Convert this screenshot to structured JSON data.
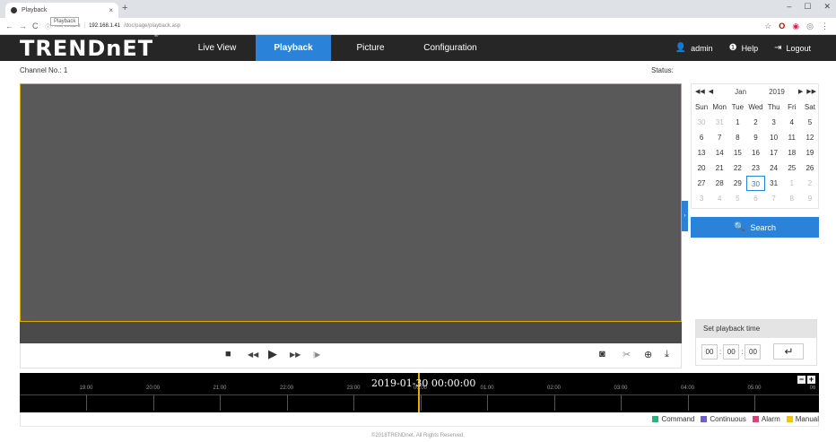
{
  "browser": {
    "tab_title": "Playback",
    "tab_close": "×",
    "new_tab": "+",
    "tooltip": "Playback",
    "not_secure": "Not secure",
    "url_host": "192.168.1.41",
    "url_path": "/doc/page/playback.asp",
    "window_controls": [
      "–",
      "☐",
      "✕"
    ]
  },
  "header": {
    "logo": "TRENDnET",
    "menu": [
      {
        "label": "Live View",
        "active": false
      },
      {
        "label": "Playback",
        "active": true
      },
      {
        "label": "Picture",
        "active": false
      },
      {
        "label": "Configuration",
        "active": false
      }
    ],
    "user": "admin",
    "help": "Help",
    "logout": "Logout"
  },
  "channel_label": "Channel No.: 1",
  "status_label": "Status:",
  "calendar": {
    "month": "Jan",
    "year": "2019",
    "dow": [
      "Sun",
      "Mon",
      "Tue",
      "Wed",
      "Thu",
      "Fri",
      "Sat"
    ],
    "weeks": [
      [
        [
          "30",
          "muted"
        ],
        [
          "31",
          "muted"
        ],
        [
          "1",
          ""
        ],
        [
          "2",
          ""
        ],
        [
          "3",
          ""
        ],
        [
          "4",
          ""
        ],
        [
          "5",
          ""
        ]
      ],
      [
        [
          "6",
          ""
        ],
        [
          "7",
          ""
        ],
        [
          "8",
          ""
        ],
        [
          "9",
          ""
        ],
        [
          "10",
          ""
        ],
        [
          "11",
          ""
        ],
        [
          "12",
          ""
        ]
      ],
      [
        [
          "13",
          ""
        ],
        [
          "14",
          ""
        ],
        [
          "15",
          ""
        ],
        [
          "16",
          ""
        ],
        [
          "17",
          ""
        ],
        [
          "18",
          ""
        ],
        [
          "19",
          ""
        ]
      ],
      [
        [
          "20",
          ""
        ],
        [
          "21",
          ""
        ],
        [
          "22",
          ""
        ],
        [
          "23",
          ""
        ],
        [
          "24",
          ""
        ],
        [
          "25",
          ""
        ],
        [
          "26",
          ""
        ]
      ],
      [
        [
          "27",
          ""
        ],
        [
          "28",
          ""
        ],
        [
          "29",
          ""
        ],
        [
          "30",
          "sel"
        ],
        [
          "31",
          ""
        ],
        [
          "1",
          "muted"
        ],
        [
          "2",
          "muted"
        ]
      ],
      [
        [
          "3",
          "muted"
        ],
        [
          "4",
          "muted"
        ],
        [
          "5",
          "muted"
        ],
        [
          "6",
          "muted"
        ],
        [
          "7",
          "muted"
        ],
        [
          "8",
          "muted"
        ],
        [
          "9",
          "muted"
        ]
      ]
    ]
  },
  "search_label": "Search",
  "playback_time": {
    "title": "Set playback time",
    "hh": "00",
    "mm": "00",
    "ss": "00"
  },
  "timeline": {
    "current": "2019-01-30 00:00:00",
    "labels": [
      "19:00",
      "20:00",
      "21:00",
      "22:00",
      "23:00",
      "00:00",
      "01:00",
      "02:00",
      "03:00",
      "04:00",
      "05:00",
      "06"
    ]
  },
  "legend": [
    {
      "label": "Command",
      "color": "#2ab37a"
    },
    {
      "label": "Continuous",
      "color": "#6a5fd6"
    },
    {
      "label": "Alarm",
      "color": "#e0407a"
    },
    {
      "label": "Manual",
      "color": "#f2c500"
    }
  ],
  "footer": "©2018TRENDnet. All Rights Reserved."
}
